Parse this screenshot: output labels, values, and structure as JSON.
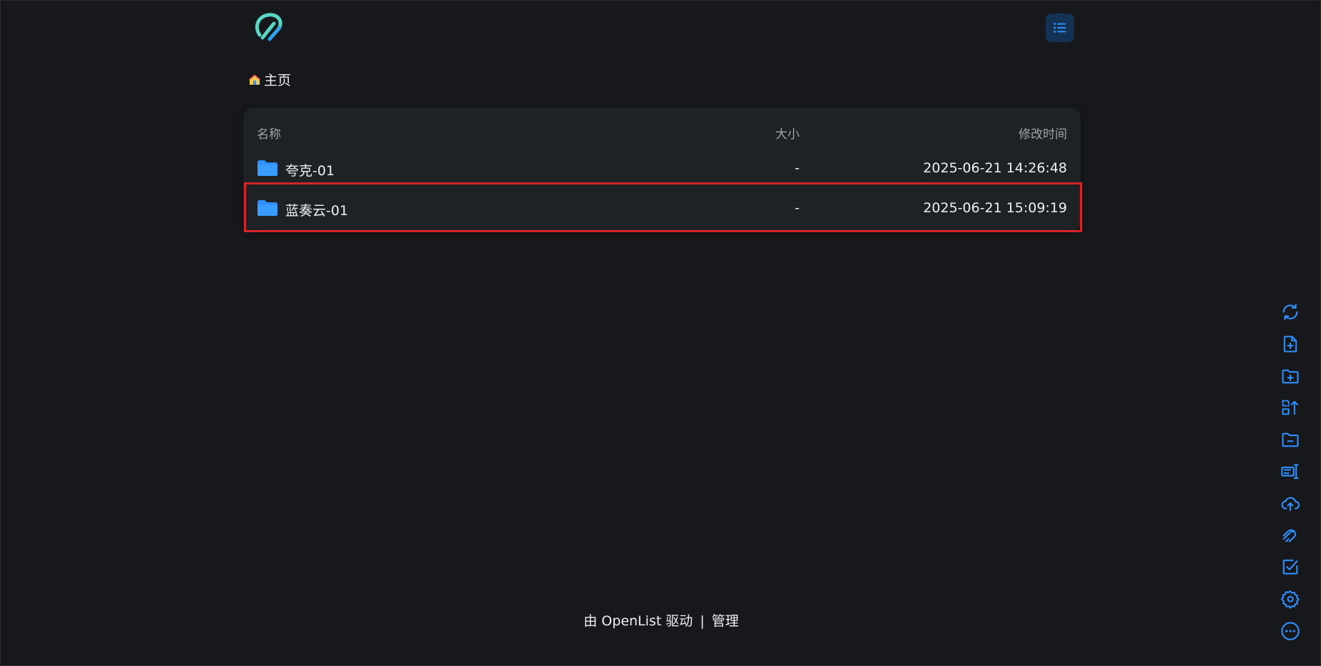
{
  "brand": {
    "logo_icon": "openlist-logo-icon",
    "logo_color": "#5ad7c4"
  },
  "header": {
    "layout_toggle_icon": "list-view-icon"
  },
  "breadcrumb": {
    "home_icon": "house-icon",
    "label": "主页"
  },
  "table": {
    "columns": {
      "name": "名称",
      "size": "大小",
      "modified": "修改时间"
    },
    "rows": [
      {
        "name": "夸克-01",
        "size": "-",
        "modified": "2025-06-21 14:26:48",
        "icon": "folder-icon"
      },
      {
        "name": "蓝奏云-01",
        "size": "-",
        "modified": "2025-06-21 15:09:19",
        "icon": "folder-icon",
        "highlighted": true
      }
    ]
  },
  "footer": {
    "powered_by": "由 OpenList 驱动",
    "separator": "|",
    "admin": "管理"
  },
  "toolbar": {
    "items": [
      {
        "name": "refresh-icon"
      },
      {
        "name": "new-file-icon"
      },
      {
        "name": "new-folder-icon"
      },
      {
        "name": "recursive-move-icon"
      },
      {
        "name": "remove-empty-folder-icon"
      },
      {
        "name": "batch-rename-icon"
      },
      {
        "name": "upload-icon"
      },
      {
        "name": "offline-download-icon"
      },
      {
        "name": "toggle-checkbox-icon"
      },
      {
        "name": "settings-icon"
      },
      {
        "name": "more-icon"
      }
    ]
  },
  "colors": {
    "accent": "#1e90ff",
    "background": "#17181b",
    "panel": "#1f2225",
    "highlight_border": "#d8232a"
  }
}
